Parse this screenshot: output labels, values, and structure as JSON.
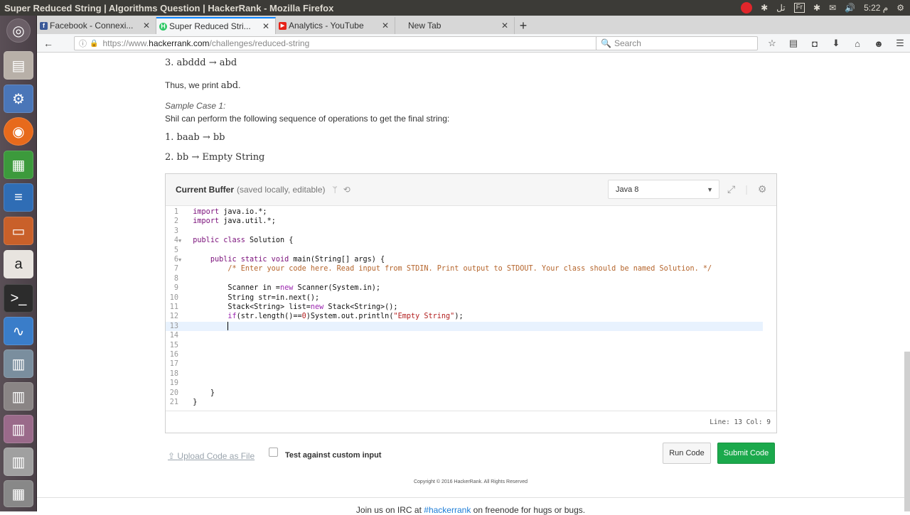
{
  "topbar": {
    "window_title": "Super Reduced String | Algorithms Question | HackerRank - Mozilla Firefox",
    "keyboard": "Fr",
    "clock": "5:22 م",
    "network_label": "ﺗﻞ"
  },
  "launcher": {
    "items": [
      "ubuntu-dash",
      "files",
      "system-settings",
      "firefox",
      "libreoffice-calc",
      "libreoffice-writer",
      "libreoffice-impress",
      "amazon",
      "terminal",
      "system-monitor",
      "workspace"
    ]
  },
  "tabs": [
    {
      "label": "Facebook - Connexi...",
      "favicon": "f",
      "color": "#3b5998"
    },
    {
      "label": "Super Reduced Stri...",
      "favicon": "H",
      "color": "#2ec866"
    },
    {
      "label": "Analytics - YouTube",
      "favicon": "▶",
      "color": "#e62117"
    },
    {
      "label": "New Tab",
      "favicon": "",
      "color": ""
    }
  ],
  "navbar": {
    "url_prefix": "https://www.",
    "url_domain": "hackerrank.com",
    "url_path": "/challenges/reduced-string",
    "search_placeholder": "Search"
  },
  "content": {
    "step3_num": "3.",
    "step3": "abddd → abd",
    "thus": "Thus, we print ",
    "thus_value": "abd",
    "thus_end": ".",
    "sample_title": "Sample Case 1:",
    "sample_desc": "Shil can perform the following sequence of operations to get the final string:",
    "ops": [
      {
        "num": "1.",
        "text": "baab → bb"
      },
      {
        "num": "2.",
        "text": "bb → Empty String"
      }
    ]
  },
  "editor": {
    "title": "Current Buffer",
    "subtitle": "(saved locally, editable)",
    "language": "Java 8",
    "status": "Line: 13 Col: 9",
    "lines": [
      {
        "n": "1",
        "text": "import java.io.*;"
      },
      {
        "n": "2",
        "text": "import java.util.*;"
      },
      {
        "n": "3",
        "text": ""
      },
      {
        "n": "4",
        "text": "public class Solution {"
      },
      {
        "n": "5",
        "text": ""
      },
      {
        "n": "6",
        "text": "    public static void main(String[] args) {"
      },
      {
        "n": "7",
        "text": "        /* Enter your code here. Read input from STDIN. Print output to STDOUT. Your class should be named Solution. */"
      },
      {
        "n": "8",
        "text": ""
      },
      {
        "n": "9",
        "text": "        Scanner in =new Scanner(System.in);"
      },
      {
        "n": "10",
        "text": "        String str=in.next();"
      },
      {
        "n": "11",
        "text": "        Stack<String> list=new Stack<String>();"
      },
      {
        "n": "12",
        "text": "        if(str.length()==0)System.out.println(\"Empty String\");"
      },
      {
        "n": "13",
        "text": "        "
      },
      {
        "n": "14",
        "text": ""
      },
      {
        "n": "15",
        "text": ""
      },
      {
        "n": "16",
        "text": ""
      },
      {
        "n": "17",
        "text": ""
      },
      {
        "n": "18",
        "text": ""
      },
      {
        "n": "19",
        "text": ""
      },
      {
        "n": "20",
        "text": "    }"
      },
      {
        "n": "21",
        "text": "}"
      }
    ]
  },
  "actions": {
    "upload": "Upload Code as File",
    "custom_input": "Test against custom input",
    "run": "Run Code",
    "submit": "Submit Code"
  },
  "footer": {
    "copyright": "Copyright © 2016 HackerRank. All Rights Reserved",
    "irc_prefix": "Join us on IRC at ",
    "irc_link": "#hackerrank",
    "irc_suffix": " on freenode for hugs or bugs."
  }
}
